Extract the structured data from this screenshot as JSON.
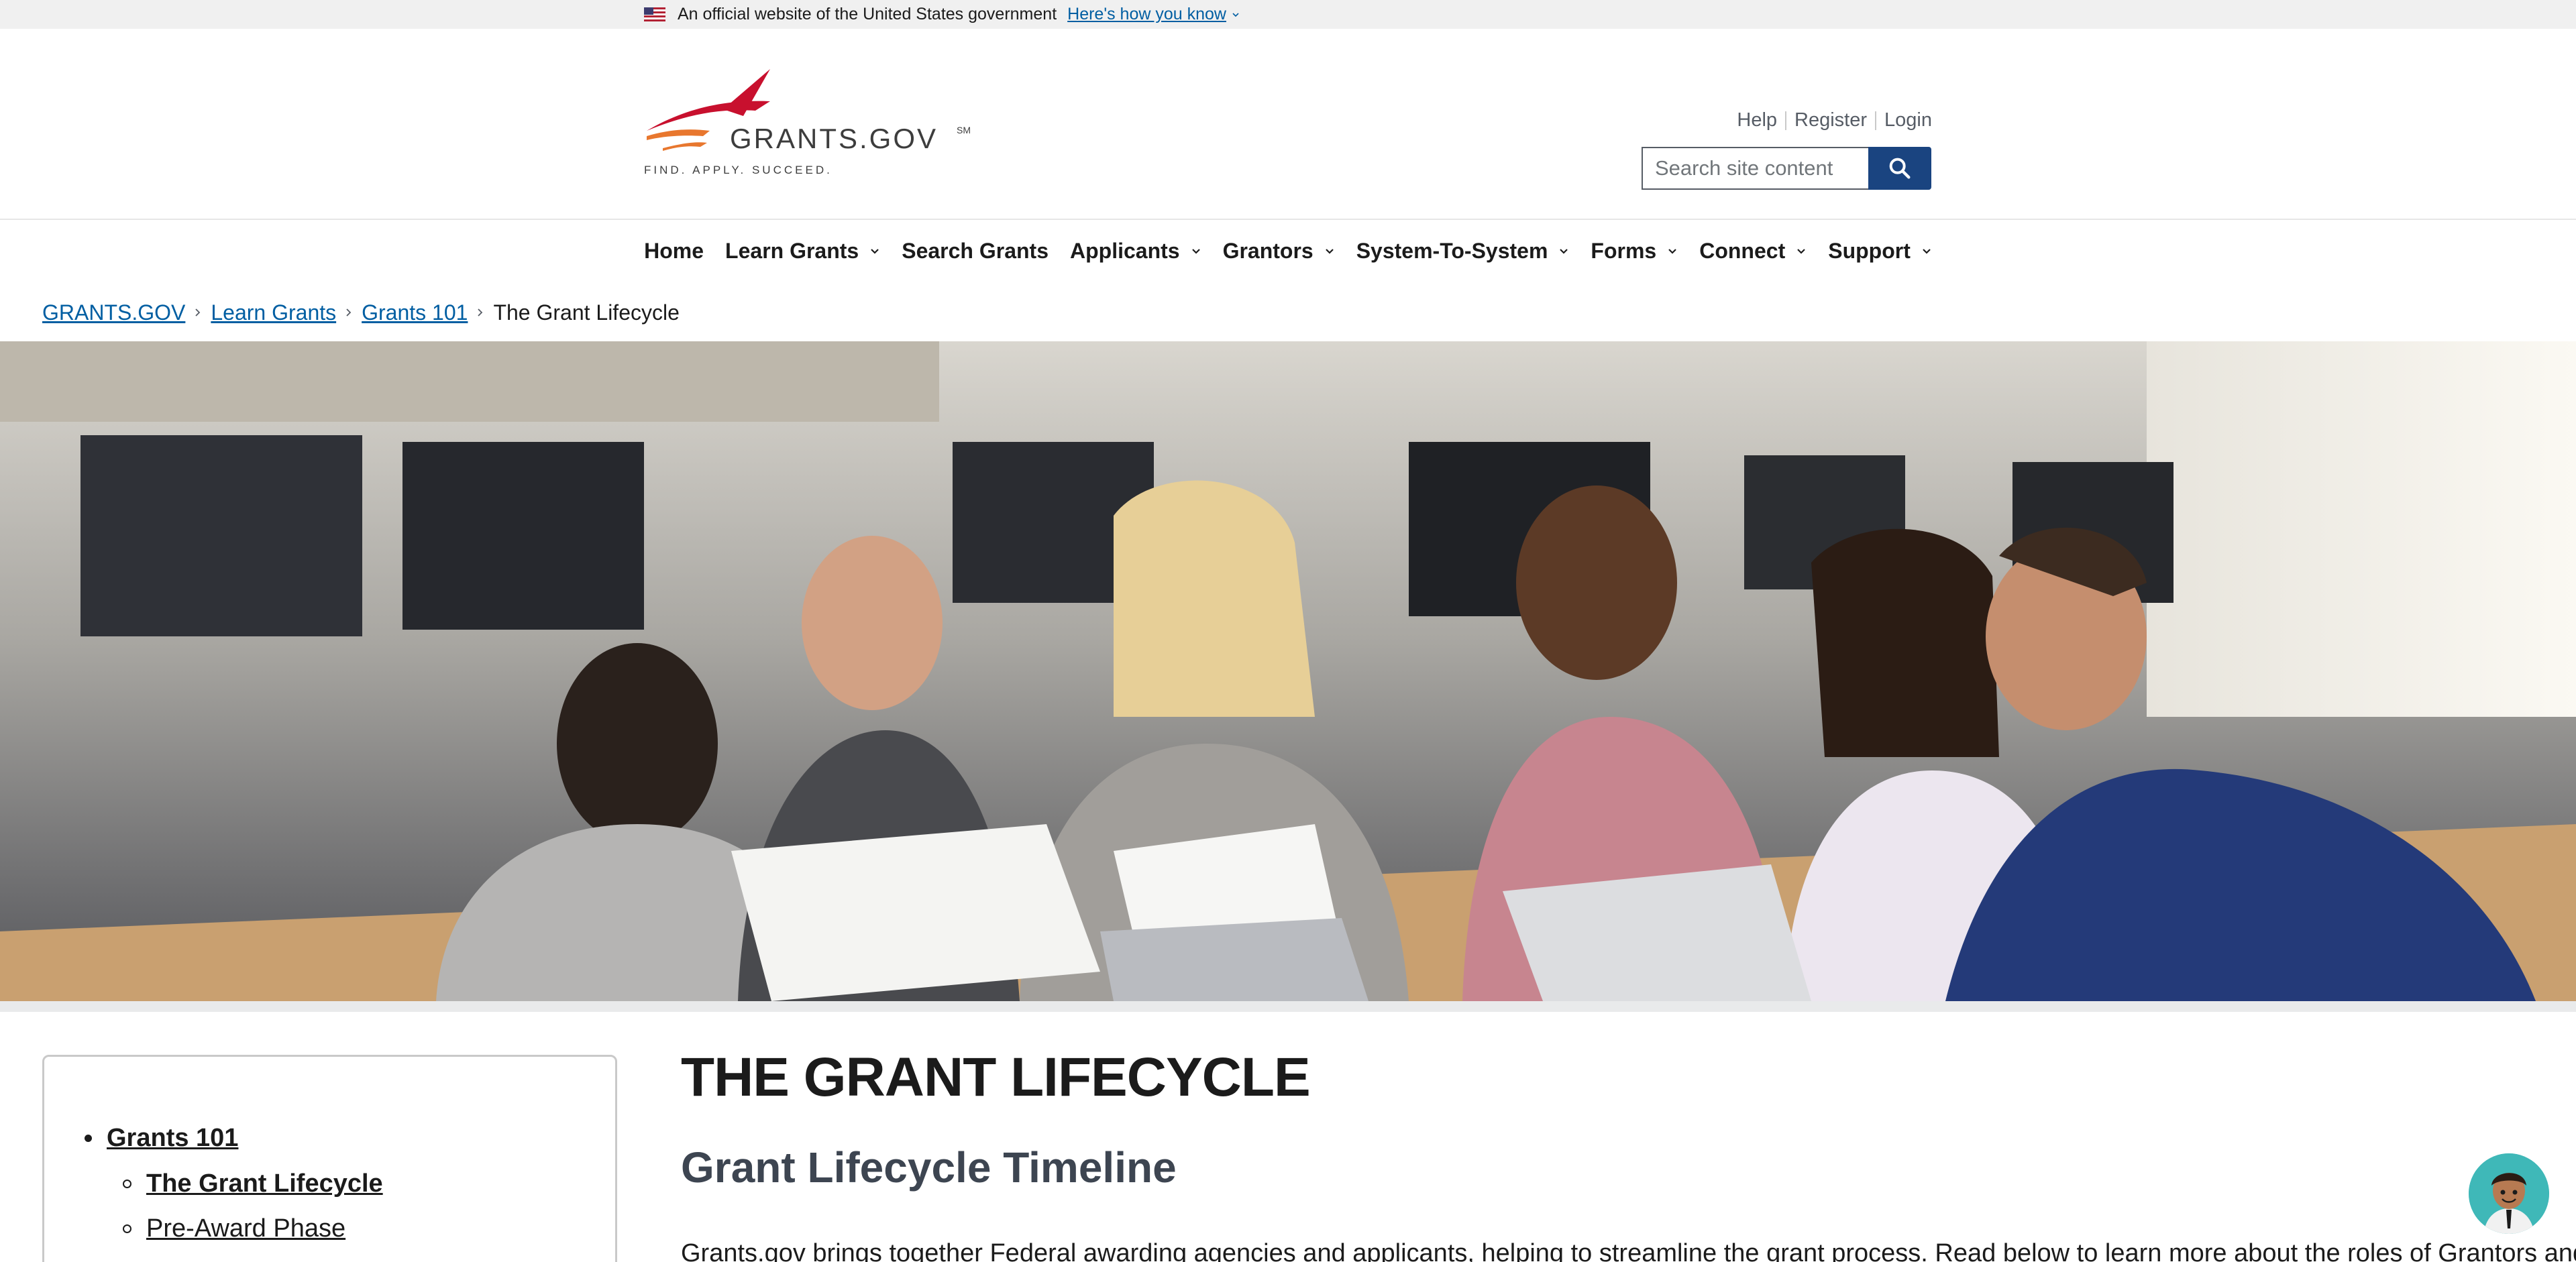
{
  "gov_banner": {
    "official_text": "An official website of the United States government",
    "how_you_know": "Here's how you know"
  },
  "header": {
    "logo_main": "GRANTS.GOV",
    "logo_mark": "SM",
    "logo_tagline": "FIND. APPLY. SUCCEED.",
    "utility_links": [
      "Help",
      "Register",
      "Login"
    ],
    "search_placeholder": "Search site content"
  },
  "nav": {
    "items": [
      {
        "label": "Home",
        "dropdown": false
      },
      {
        "label": "Learn Grants",
        "dropdown": true
      },
      {
        "label": "Search Grants",
        "dropdown": false
      },
      {
        "label": "Applicants",
        "dropdown": true
      },
      {
        "label": "Grantors",
        "dropdown": true
      },
      {
        "label": "System-To-System",
        "dropdown": true
      },
      {
        "label": "Forms",
        "dropdown": true
      },
      {
        "label": "Connect",
        "dropdown": true
      },
      {
        "label": "Support",
        "dropdown": true
      }
    ]
  },
  "breadcrumb": {
    "items": [
      "GRANTS.GOV",
      "Learn Grants",
      "Grants 101"
    ],
    "current": "The Grant Lifecycle"
  },
  "sidebar": {
    "parent": "Grants 101",
    "children": [
      "The Grant Lifecycle",
      "Pre-Award Phase"
    ]
  },
  "main": {
    "title": "THE GRANT LIFECYCLE",
    "section_title": "Grant Lifecycle Timeline",
    "intro": "Grants.gov brings together Federal awarding agencies and applicants, helping to streamline the grant process. Read below to learn more about the roles of Grantors and"
  },
  "colors": {
    "link": "#005ea2",
    "search_button": "#1a4480",
    "logo_red": "#c8102e",
    "chat_bg": "#3fb8b8"
  }
}
